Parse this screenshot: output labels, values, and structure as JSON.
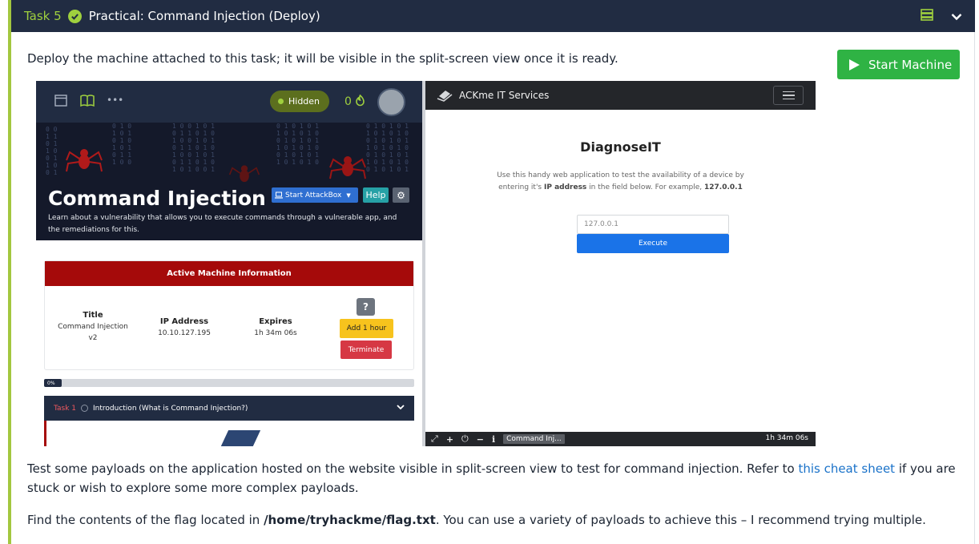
{
  "task": {
    "number": "Task 5",
    "title": "Practical: Command Injection (Deploy)"
  },
  "intro_text": "Deploy the machine attached to this task; it will be visible in the split-screen view once it is ready.",
  "start_machine_label": "Start Machine",
  "screenshot": {
    "thm": {
      "hidden_label": "Hidden",
      "streak_count": "0",
      "hero_title": "Command Injection",
      "hero_subtitle": "Learn about a vulnerability that allows you to execute commands through a vulnerable app, and the remediations for this.",
      "attackbox_label": "Start AttackBox",
      "help_label": "Help",
      "active_machine_heading": "Active Machine Information",
      "title_label": "Title",
      "title_value": "Command Injection v2",
      "ip_label": "IP Address",
      "ip_value": "10.10.127.195",
      "expires_label": "Expires",
      "expires_value": "1h 34m 06s",
      "question_mark": "?",
      "add_hour_label": "Add 1 hour",
      "terminate_label": "Terminate",
      "progress_label": "0%",
      "task1_number": "Task 1",
      "task1_title": "Introduction (What is Command Injection?)"
    },
    "app": {
      "brand": "ACKme IT Services",
      "title": "DiagnoseIT",
      "desc_part1": "Use this handy web application to test the availability of a device by entering it's ",
      "desc_bold1": "IP address",
      "desc_part2": " in the field below. For example, ",
      "desc_bold2": "127.0.0.1",
      "input_placeholder": "127.0.0.1",
      "execute_label": "Execute",
      "tab_label": "Command Inj...",
      "timer": "1h 34m 06s"
    }
  },
  "para2": {
    "before_link": "Test some payloads on the application hosted on the website visible in split-screen view to test for command injection. Refer to ",
    "link_text": "this cheat sheet",
    "after_link": " if you are stuck or wish to explore some more complex payloads."
  },
  "para3": {
    "before": "Find the contents of the flag located in ",
    "path": "/home/tryhackme/flag.txt",
    "after": ". You can use a variety of payloads to achieve this – I recommend trying multiple."
  },
  "colors": {
    "header_bg": "#212c42",
    "accent_green": "#9fd03e",
    "start_button": "#2fb344",
    "link": "#1a72c9"
  }
}
